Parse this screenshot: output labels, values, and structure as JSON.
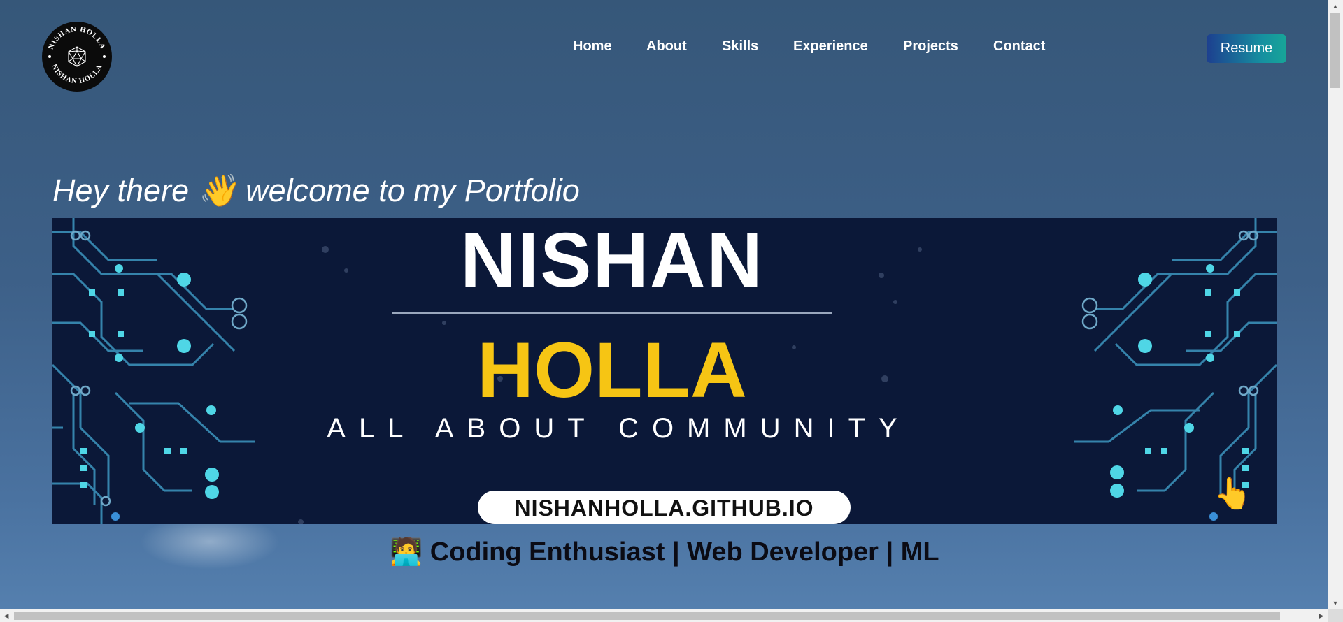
{
  "logo": {
    "ring_text": "NISHAN HOLLA",
    "icon": "icosahedron-icon"
  },
  "nav": {
    "items": [
      "Home",
      "About",
      "Skills",
      "Experience",
      "Projects",
      "Contact"
    ]
  },
  "resume_button": "Resume",
  "hero": {
    "welcome_text": "Hey there 👋 welcome to my Portfolio",
    "banner": {
      "first_name": "NISHAN",
      "last_name": "HOLLA",
      "tagline": "ALL ABOUT COMMUNITY",
      "url": "NISHANHOLLA.GITHUB.IO",
      "pointer_icon": "👆"
    },
    "subtitle_emoji": "🧑‍💻",
    "subtitle": "Coding Enthusiast | Web Developer | ML"
  },
  "colors": {
    "background": "#3d6088",
    "banner_bg": "#0b1838",
    "accent_yellow": "#f6c514",
    "circuit_cyan": "#4fd6e6",
    "resume_gradient_start": "#1d3f8f",
    "resume_gradient_end": "#17a598"
  }
}
